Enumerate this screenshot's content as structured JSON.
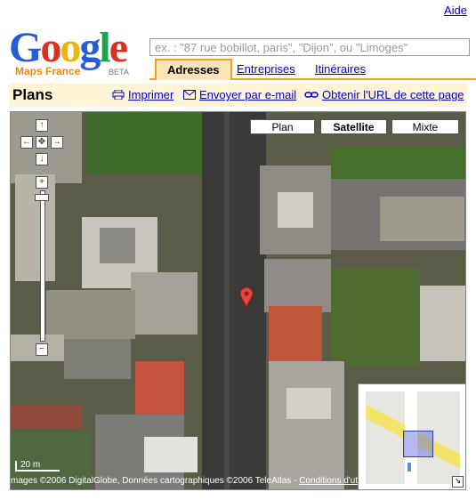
{
  "header": {
    "help_label": "Aide",
    "logo": {
      "word": "Google",
      "subtitle": "Maps France",
      "badge": "BETA"
    },
    "search": {
      "placeholder": "ex. : \"87 rue bobillot, paris\", \"Dijon\", ou \"Limoges\""
    },
    "tabs": [
      {
        "label": "Adresses",
        "active": true
      },
      {
        "label": "Entreprises",
        "active": false
      },
      {
        "label": "Itinéraires",
        "active": false
      }
    ]
  },
  "titlebar": {
    "title": "Plans",
    "print_label": "Imprimer",
    "email_label": "Envoyer par e-mail",
    "link_label": "Obtenir l'URL de cette page"
  },
  "map": {
    "map_types": [
      {
        "label": "Plan",
        "active": false
      },
      {
        "label": "Satellite",
        "active": true
      },
      {
        "label": "Mixte",
        "active": false
      }
    ],
    "scale_label": "20 m",
    "attribution": {
      "text": "mages ©2006 DigitalGlobe, Données cartographiques ©2006 TeleAtlas - ",
      "terms_label": "Conditions d'utilisation"
    },
    "marker_color": "#e8453c"
  },
  "colors": {
    "tab_accent": "#e5a426",
    "tab_bg": "#fde4b8",
    "titlebar_bg": "#fff4d6",
    "link": "#0000cc"
  }
}
